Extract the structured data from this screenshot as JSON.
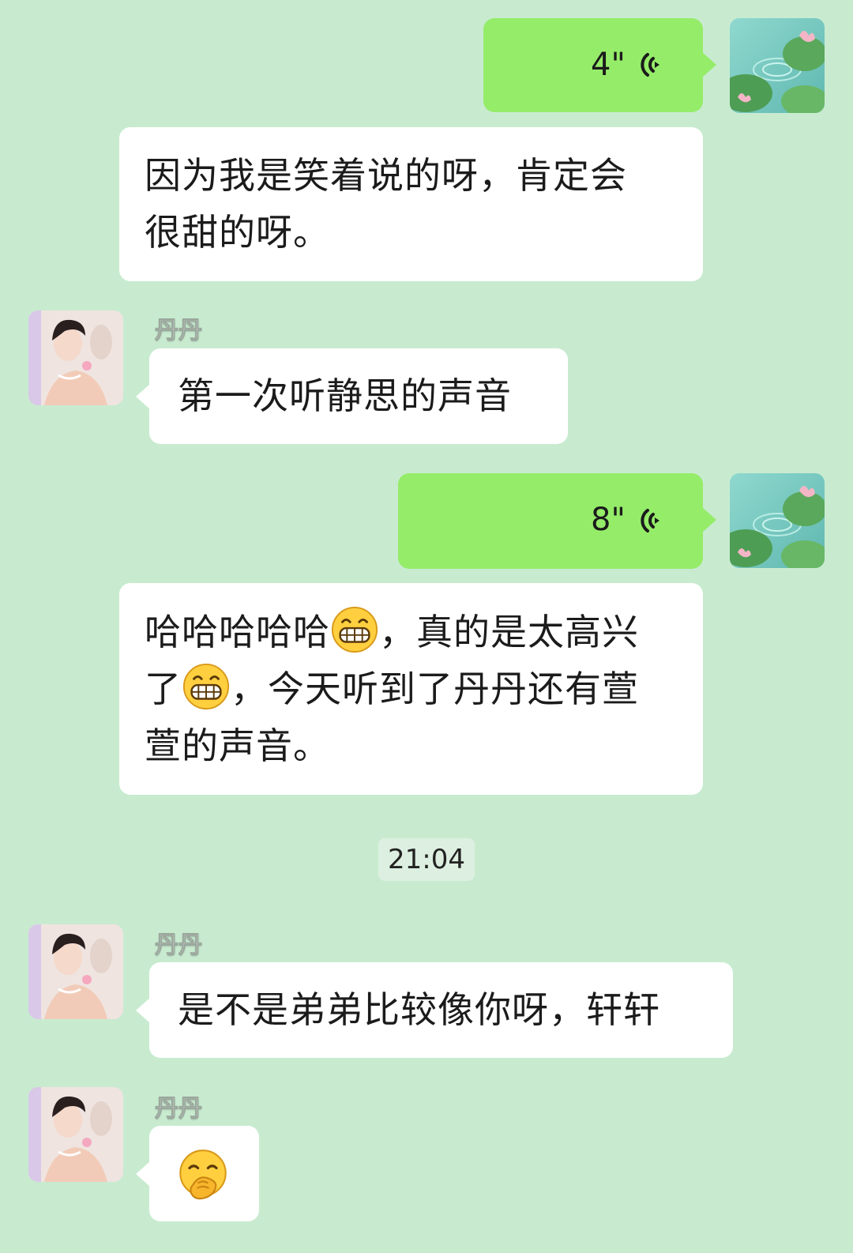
{
  "messages": [
    {
      "id": "m1",
      "side": "right",
      "type": "voice",
      "duration": "4\""
    },
    {
      "id": "m2",
      "side": "right",
      "type": "text",
      "lines": [
        "因为我是笑着说的呀，肯定会",
        "很甜的呀。"
      ]
    },
    {
      "id": "m3",
      "side": "left",
      "type": "text",
      "sender": "丹丹",
      "text": "第一次听静思的声音"
    },
    {
      "id": "m4",
      "side": "right",
      "type": "voice",
      "duration": "8\""
    },
    {
      "id": "m5",
      "side": "right",
      "type": "text",
      "line1_a": "哈哈哈哈哈",
      "line1_b": "，真的是太高兴",
      "line2_a": "了",
      "line2_b": "，今天听到了丹丹还有萱",
      "line3": "萱的声音。",
      "emoji": "grinning-face-icon"
    },
    {
      "id": "m6",
      "side": "left",
      "type": "text",
      "sender": "丹丹",
      "text": "是不是弟弟比较像你呀，轩轩"
    },
    {
      "id": "m7",
      "side": "left",
      "type": "sticker",
      "sender": "丹丹",
      "emoji": "face-with-hand-over-mouth-icon"
    }
  ],
  "timestamp": "21:04",
  "colors": {
    "background": "#c8ebd0",
    "own_bubble": "#95ec69",
    "other_bubble": "#ffffff",
    "voice_icon": "#1b1b1b"
  }
}
